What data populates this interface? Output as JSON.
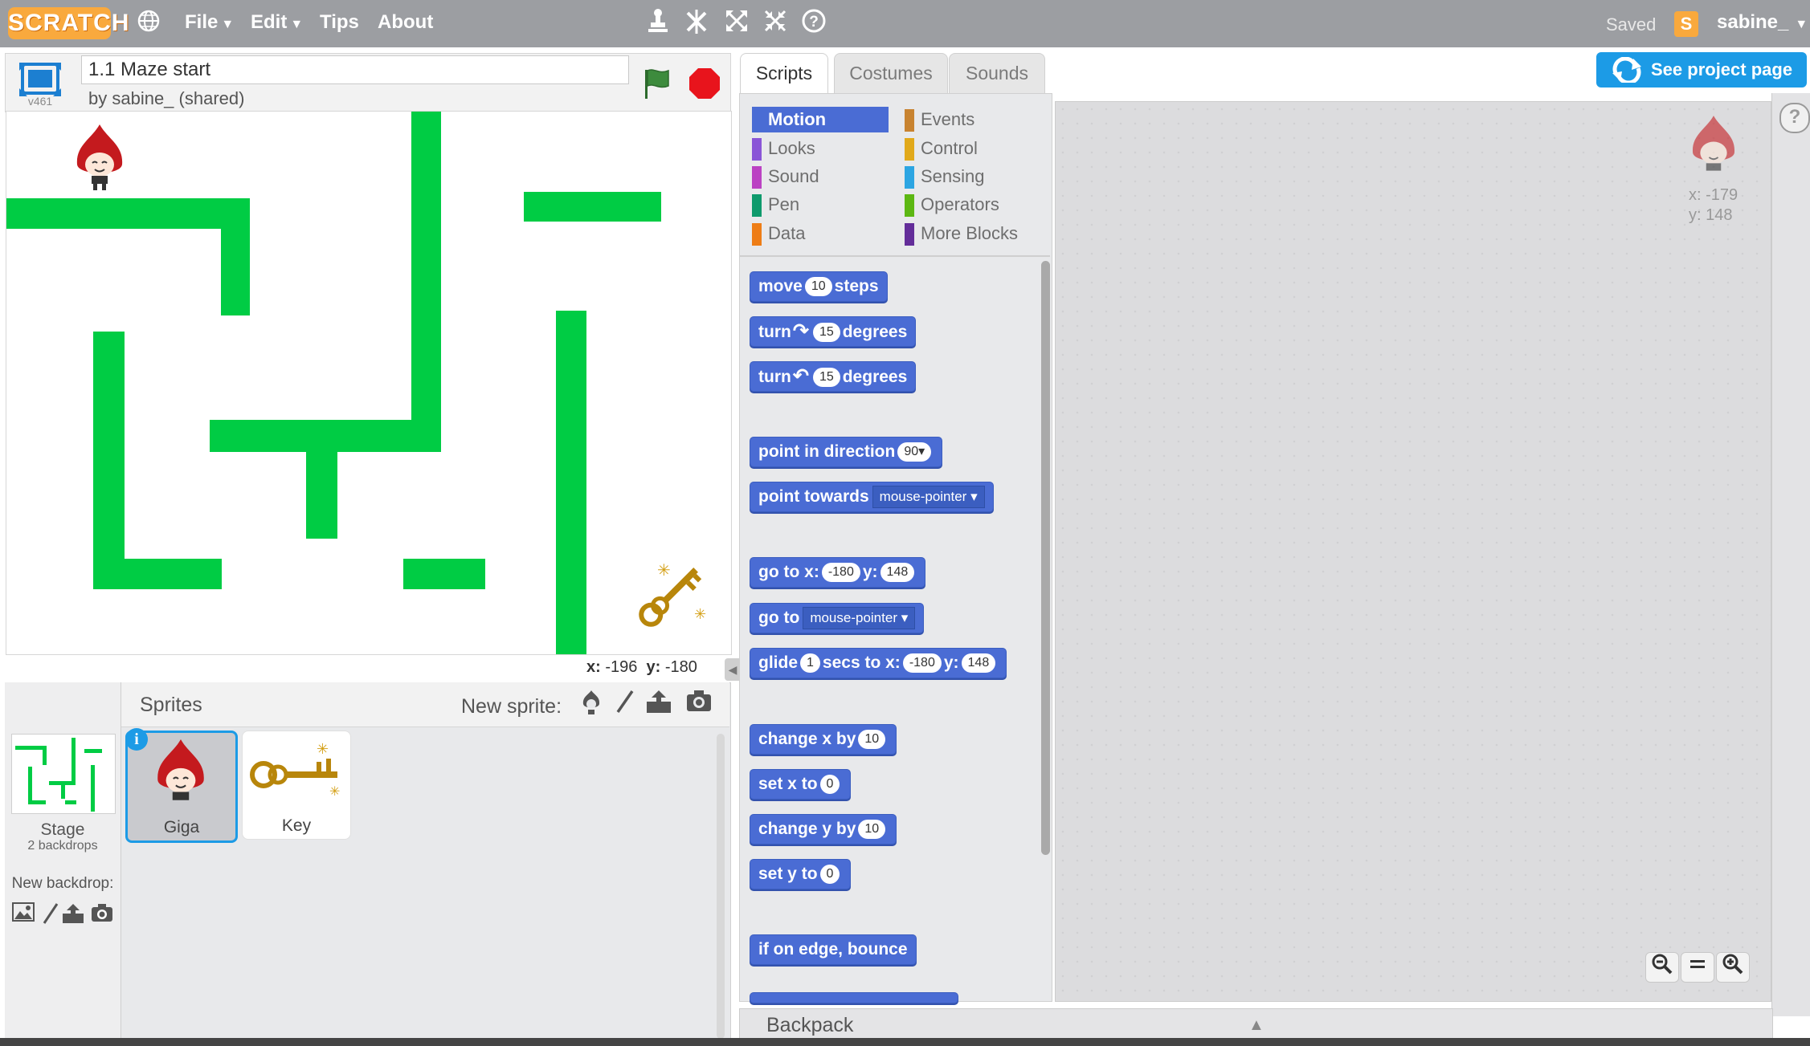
{
  "topbar": {
    "logo": "SCRATCH",
    "menus": [
      {
        "label": "File",
        "has_arrow": true
      },
      {
        "label": "Edit",
        "has_arrow": true
      },
      {
        "label": "Tips",
        "has_arrow": false
      },
      {
        "label": "About",
        "has_arrow": false
      }
    ],
    "tool_icons": [
      "duplicate-icon",
      "delete-icon",
      "grow-icon",
      "shrink-icon",
      "help-icon"
    ],
    "saved_status": "Saved",
    "username": "sabine_"
  },
  "stage_header": {
    "version": "v461",
    "project_title": "1.1 Maze start",
    "byline": "by sabine_ (shared)"
  },
  "stage": {
    "coords_x_label": "x:",
    "coords_x_value": "-196",
    "coords_y_label": "y:",
    "coords_y_value": "-180",
    "wall_color": "#00cc44"
  },
  "sprites_pane": {
    "title": "Sprites",
    "new_sprite_label": "New sprite:",
    "stage_label": "Stage",
    "backdrop_count": "2 backdrops",
    "new_backdrop_label": "New backdrop:",
    "sprites": [
      {
        "name": "Giga",
        "selected": true
      },
      {
        "name": "Key",
        "selected": false
      }
    ]
  },
  "tabs": {
    "scripts": "Scripts",
    "costumes": "Costumes",
    "sounds": "Sounds",
    "active": "Scripts"
  },
  "see_project_page": "See project page",
  "categories": {
    "left": [
      {
        "label": "Motion",
        "color": "#4a6cd4",
        "active": true
      },
      {
        "label": "Looks",
        "color": "#8a55d7"
      },
      {
        "label": "Sound",
        "color": "#bb42c3"
      },
      {
        "label": "Pen",
        "color": "#0e9a6c"
      },
      {
        "label": "Data",
        "color": "#ee7d16"
      }
    ],
    "right": [
      {
        "label": "Events",
        "color": "#c88330"
      },
      {
        "label": "Control",
        "color": "#e1a91a"
      },
      {
        "label": "Sensing",
        "color": "#2ca5e2"
      },
      {
        "label": "Operators",
        "color": "#5cb712"
      },
      {
        "label": "More Blocks",
        "color": "#632d99"
      }
    ]
  },
  "blocks": {
    "move": {
      "pre": "move",
      "value": "10",
      "post": "steps"
    },
    "turn_right": {
      "pre": "turn",
      "value": "15",
      "post": "degrees"
    },
    "turn_left": {
      "pre": "turn",
      "value": "15",
      "post": "degrees"
    },
    "point_dir": {
      "pre": "point in direction",
      "value": "90"
    },
    "point_towards": {
      "pre": "point towards",
      "dropdown": "mouse-pointer"
    },
    "goto_xy": {
      "pre": "go to x:",
      "x": "-180",
      "ymid": "y:",
      "y": "148"
    },
    "goto": {
      "pre": "go to",
      "dropdown": "mouse-pointer"
    },
    "glide": {
      "pre": "glide",
      "secs": "1",
      "mid": "secs to x:",
      "x": "-180",
      "ymid": "y:",
      "y": "148"
    },
    "change_x": {
      "pre": "change x by",
      "value": "10"
    },
    "set_x": {
      "pre": "set x to",
      "value": "0"
    },
    "change_y": {
      "pre": "change y by",
      "value": "10"
    },
    "set_y": {
      "pre": "set y to",
      "value": "0"
    },
    "bounce": {
      "label": "if on edge, bounce"
    }
  },
  "script_area": {
    "sprite_x": "x: -179",
    "sprite_y": "y: 148"
  },
  "backpack_label": "Backpack"
}
